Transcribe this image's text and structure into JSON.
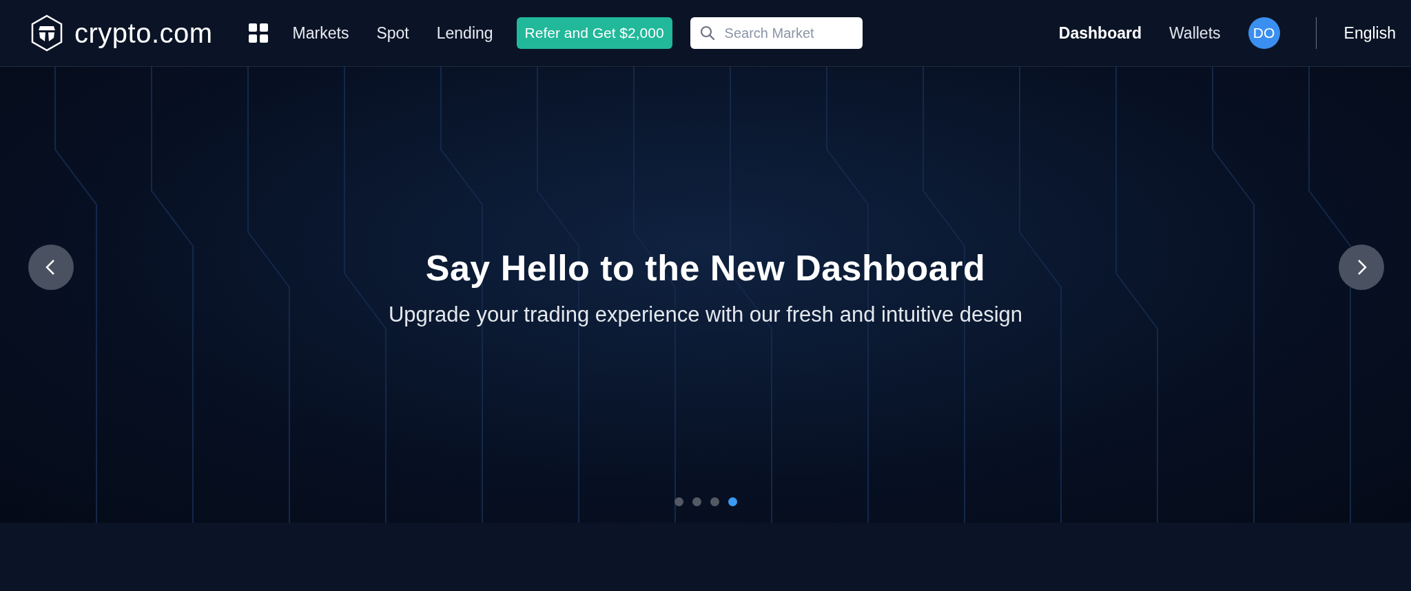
{
  "header": {
    "logo_text": "crypto.com",
    "nav": [
      {
        "label": "Markets"
      },
      {
        "label": "Spot"
      },
      {
        "label": "Lending"
      }
    ],
    "promo_button": "Refer and Get $2,000",
    "search": {
      "placeholder": "Search Market"
    },
    "right_nav": [
      {
        "label": "Dashboard",
        "selected": true
      },
      {
        "label": "Wallets",
        "selected": false
      }
    ],
    "avatar": "DO",
    "language": "English"
  },
  "banner": {
    "title": "Say Hello to the New Dashboard",
    "subtitle": "Upgrade your trading experience with our fresh and intuitive design",
    "slides": [
      {
        "selected": false
      },
      {
        "selected": false
      },
      {
        "selected": false
      },
      {
        "selected": true
      }
    ]
  }
}
